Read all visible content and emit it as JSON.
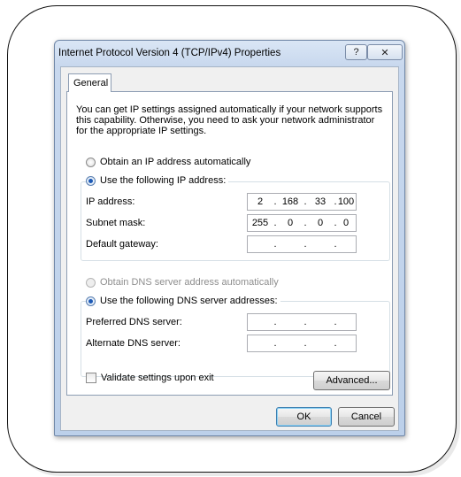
{
  "window": {
    "title": "Internet Protocol Version 4 (TCP/IPv4) Properties",
    "help_label": "?",
    "close_label": "✕"
  },
  "tabs": [
    {
      "label": "General",
      "selected": true
    }
  ],
  "intro": {
    "lines": [
      "You can get IP settings assigned automatically if your network supports",
      "this capability. Otherwise, you need to ask your network administrator",
      "for the appropriate IP settings."
    ]
  },
  "ip_mode": {
    "auto_label": "Obtain an IP address automatically",
    "manual_label": "Use the following IP address:",
    "selected": "manual"
  },
  "ip_fields": [
    {
      "label": "IP address:",
      "octets": [
        "2",
        "168",
        "33",
        "100"
      ]
    },
    {
      "label": "Subnet mask:",
      "octets": [
        "255",
        "0",
        "0",
        "0"
      ]
    },
    {
      "label": "Default gateway:",
      "octets": [
        "",
        "",
        "",
        ""
      ]
    }
  ],
  "dns_mode": {
    "auto_label": "Obtain DNS server address automatically",
    "manual_label": "Use the following DNS server addresses:",
    "selected": "manual"
  },
  "dns_fields": [
    {
      "label": "Preferred DNS server:",
      "octets": [
        "",
        "",
        "",
        ""
      ]
    },
    {
      "label": "Alternate DNS server:",
      "octets": [
        "",
        "",
        "",
        ""
      ]
    }
  ],
  "validate": {
    "label": "Validate settings upon exit",
    "checked": false
  },
  "buttons": {
    "advanced": "Advanced...",
    "ok": "OK",
    "cancel": "Cancel"
  }
}
